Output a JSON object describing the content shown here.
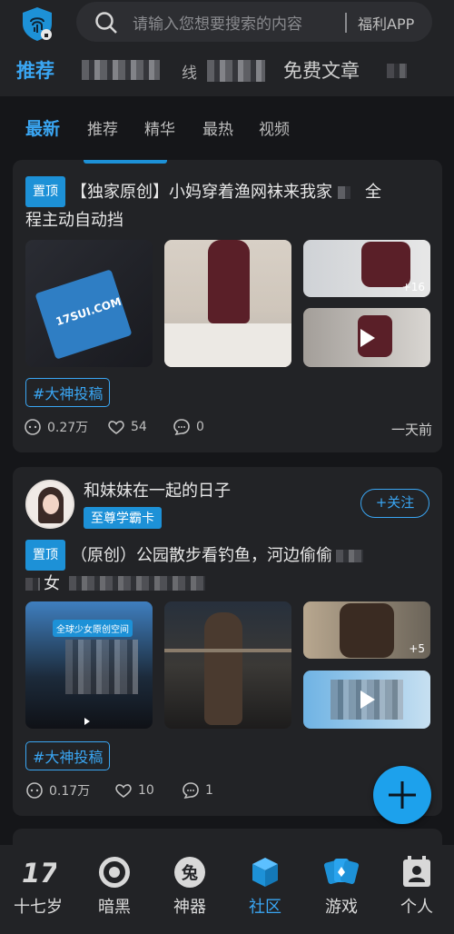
{
  "search": {
    "placeholder": "请输入您想要搜索的内容",
    "fuli_label": "福利APP"
  },
  "categories": [
    {
      "label": "推荐",
      "active": true
    },
    {
      "label": "线",
      "active": false
    },
    {
      "label": "免费文章",
      "active": false
    }
  ],
  "subtabs": [
    "最新",
    "推荐",
    "精华",
    "最热",
    "视频"
  ],
  "posts": [
    {
      "pinned_label": "置顶",
      "title_a": "【独家原创】小妈穿着渔网袜来我家",
      "title_b": "全",
      "title_line2": "程主动自动挡",
      "thumb_text": "17SUI.COM",
      "extra_count": "+16",
      "tag": "#大神投稿",
      "views": "0.27万",
      "likes": "54",
      "comments": "0",
      "time": "一天前"
    },
    {
      "author": "和妹妹在一起的日子",
      "author_badge": "至尊学霸卡",
      "follow_label": "+关注",
      "pinned_label": "置顶",
      "title_a": "（原创）公园散步看钓鱼，河边偷偷",
      "title_line2": "女",
      "thumb_text": "全球少女原创空间",
      "extra_count": "+5",
      "tag": "#大神投稿",
      "views": "0.17万",
      "likes": "10",
      "comments": "1"
    }
  ],
  "bottom_nav": [
    {
      "label": "十七岁",
      "icon": "seventeen-logo-icon",
      "active": false
    },
    {
      "label": "暗黑",
      "icon": "dark-disc-icon",
      "active": false
    },
    {
      "label": "神器",
      "icon": "tool-icon",
      "active": false
    },
    {
      "label": "社区",
      "icon": "community-box-icon",
      "active": true
    },
    {
      "label": "游戏",
      "icon": "cards-icon",
      "active": false
    },
    {
      "label": "个人",
      "icon": "profile-icon",
      "active": false
    }
  ],
  "nav_icon_texts": {
    "seventeen": "17",
    "tool": "兔"
  },
  "colors": {
    "accent": "#3aa6f3",
    "background": "#151619",
    "card": "#222326",
    "pinned": "#1d91d7"
  }
}
